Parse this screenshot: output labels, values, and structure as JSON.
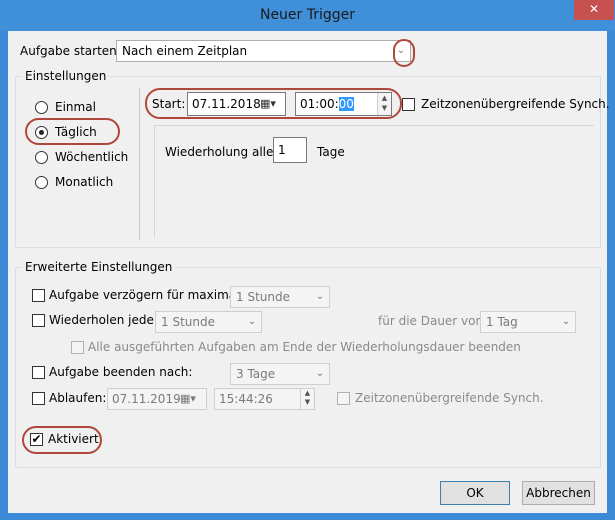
{
  "window": {
    "title": "Neuer Trigger",
    "close_icon": "✕"
  },
  "begin": {
    "label": "Aufgabe starten:",
    "value": "Nach einem Zeitplan"
  },
  "settings": {
    "title": "Einstellungen",
    "options": [
      {
        "label": "Einmal",
        "checked": false
      },
      {
        "label": "Täglich",
        "checked": true
      },
      {
        "label": "Wöchentlich",
        "checked": false
      },
      {
        "label": "Monatlich",
        "checked": false
      }
    ],
    "start_label": "Start:",
    "start_date": "07.11.2018",
    "start_time_prefix": "01:00:",
    "start_time_selected": "00",
    "sync_label": "Zeitzonenübergreifende Synch.",
    "recur_label": "Wiederholung alle:",
    "recur_value": "1",
    "recur_unit": "Tage"
  },
  "advanced": {
    "title": "Erweiterte Einstellungen",
    "delay_label": "Aufgabe verzögern für maximal:",
    "delay_value": "1 Stunde",
    "repeat_label": "Wiederholen jede:",
    "repeat_value": "1 Stunde",
    "duration_label": "für die Dauer von:",
    "duration_value": "1 Tag",
    "stop_all_label": "Alle ausgeführten Aufgaben am Ende der Wiederholungsdauer beenden",
    "stop_label": "Aufgabe beenden nach:",
    "stop_value": "3 Tage",
    "expire_label": "Ablaufen:",
    "expire_date": "07.11.2019",
    "expire_time": "15:44:26",
    "expire_sync_label": "Zeitzonenübergreifende Synch.",
    "enabled_label": "Aktiviert",
    "enabled_checkmark": "✔"
  },
  "buttons": {
    "ok": "OK",
    "cancel": "Abbrechen"
  }
}
